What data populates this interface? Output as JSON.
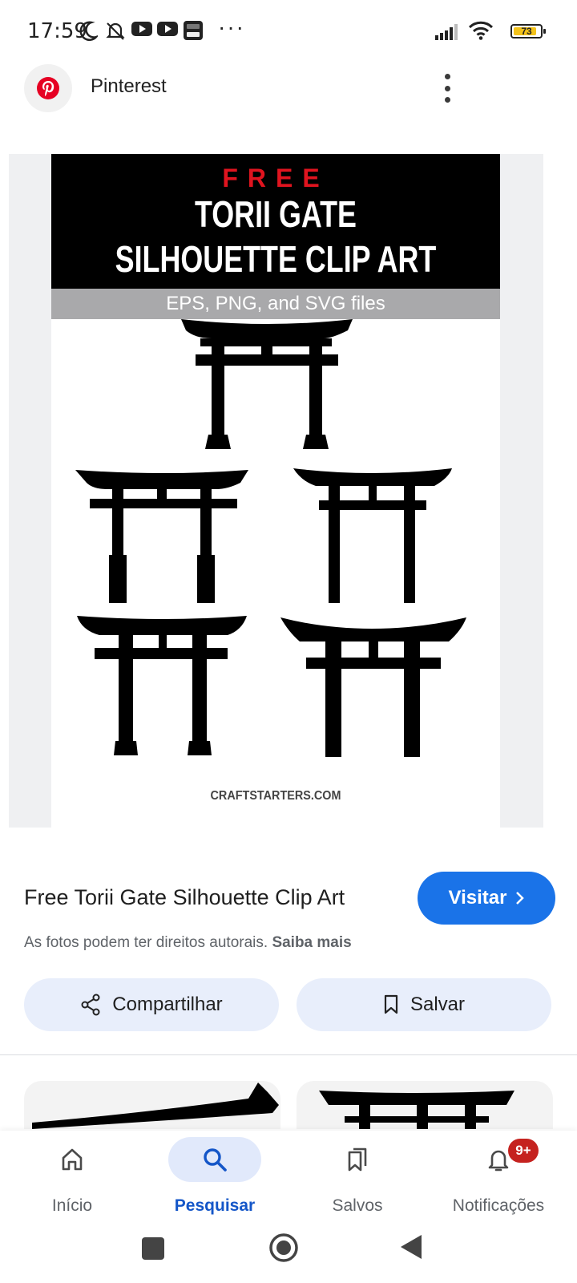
{
  "status_bar": {
    "time": "17:59",
    "overflow": "···",
    "battery_level": "73",
    "icons": [
      "moon-icon",
      "bell-off-icon",
      "youtube-icon",
      "youtube-icon",
      "app-icon",
      "signal-icon",
      "wifi-icon",
      "battery-icon"
    ]
  },
  "header": {
    "app_name": "Pinterest",
    "brand_color": "#e60023"
  },
  "image": {
    "headline_free": "FREE",
    "headline_line1": "TORII GATE",
    "headline_line2": "SILHOUETTE CLIP ART",
    "subheadline": "EPS, PNG, and SVG files",
    "credit": "CRAFTSTARTERS.COM"
  },
  "pin": {
    "title": "Free Torii Gate Silhouette Clip Art",
    "visit_label": "Visitar",
    "copyright_text": "As fotos podem ter direitos autorais.",
    "learn_more": "Saiba mais"
  },
  "actions": {
    "share_label": "Compartilhar",
    "save_label": "Salvar"
  },
  "bottom_nav": {
    "items": [
      {
        "label": "Início",
        "icon": "home-icon",
        "active": false
      },
      {
        "label": "Pesquisar",
        "icon": "search-icon",
        "active": true
      },
      {
        "label": "Salvos",
        "icon": "bookmarks-icon",
        "active": false
      },
      {
        "label": "Notificações",
        "icon": "bell-icon",
        "active": false,
        "badge": "9+"
      }
    ]
  },
  "colors": {
    "accent": "#1a73e8",
    "pill_bg": "#e8eefb",
    "badge": "#c5221f"
  }
}
